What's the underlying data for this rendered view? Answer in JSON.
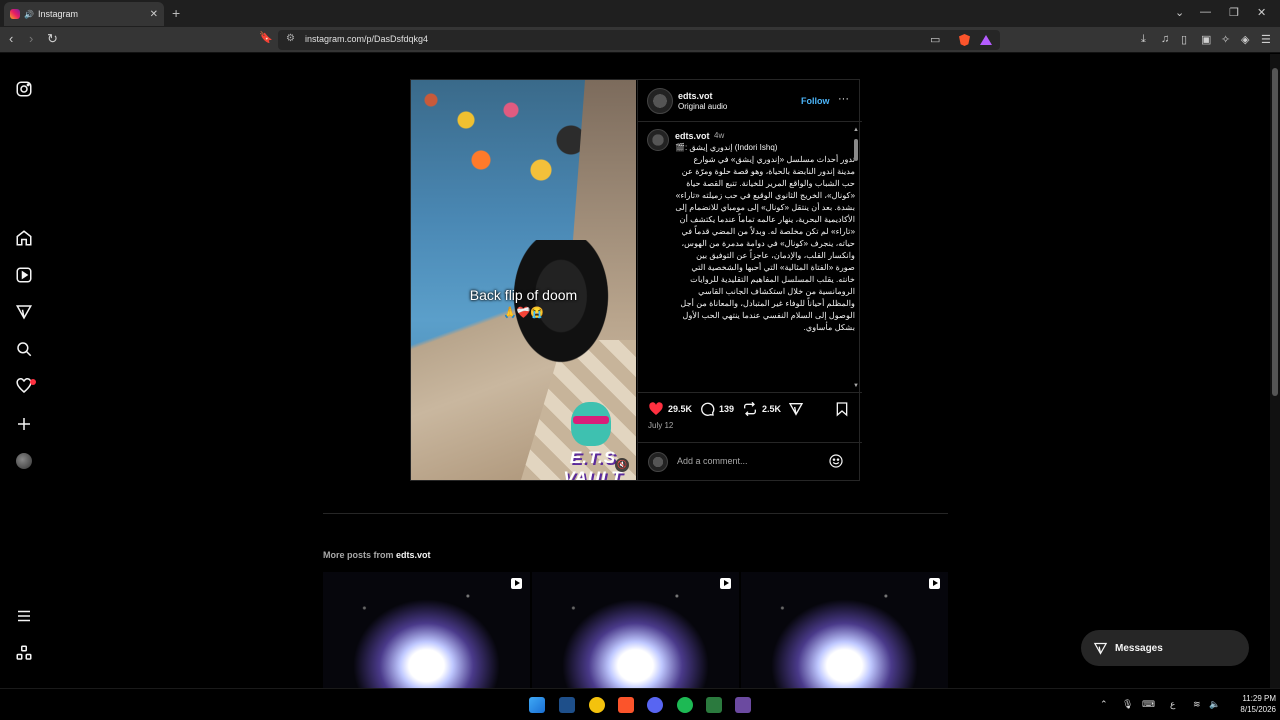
{
  "browser": {
    "tab_title": "Instagram",
    "tab_close": "✕",
    "new_tab": "+",
    "url": "instagram.com/p/DasDsfdqkg4",
    "window_controls": [
      "⌄",
      "—",
      "❐",
      "✕"
    ]
  },
  "post": {
    "username": "edts.vot",
    "audio": "Original audio",
    "follow_label": "Follow",
    "more_label": "···",
    "video_caption": "Back flip of doom",
    "video_caption_emoji": "🙏❤️‍🩹😭",
    "watermark": "E.T.S VAULT",
    "caption_user": "edts.vot",
    "caption_age": "4w",
    "caption_title": "🎬: إندوري إيشق (Indori Ishq)",
    "caption_body": "تدور أحداث مسلسل «إندوري إيشق» في شوارع مدينة إندور النابضة بالحياة، وهو قصة حلوة ومرّة عن حب الشباب والواقع المرير للخيانة. تتبع القصة حياة «كونال»، الخريج الثانوي الوقيع في حب زميلته «تاراء» بشدة. بعد أن ينتقل «كونال» إلى مومباي للانضمام إلى الأكاديمية البحرية، ينهار عالمه تماماً عندما يكتشف أن «تاراء» لم تكن مخلصة له. وبدلاً من المضي قدماً في حياته، ينجرف «كونال» في دوامة مدمرة من الهوس، وانكسار القلب، والإدمان، عاجزاً عن التوفيق بين صورة «الفتاة المثالية» التي أحبها والشخصية التي خانته. يقلب المسلسل المفاهيم التقليدية للروايات الرومانسية من خلال استكشاف الجانب القاسي والمظلم أحياناً للوفاء غير المتبادل، والمعاناة من أجل الوصول إلى السلام النفسي عندما ينتهي الحب الأول بشكل مأساوي.",
    "likes": "29.5K",
    "comments": "139",
    "reposts": "2.5K",
    "date": "July 12",
    "add_comment_placeholder": "Add a comment..."
  },
  "more_posts": {
    "prefix": "More posts from ",
    "user": "edts.vot"
  },
  "messages_label": "Messages",
  "nav_icons": [
    "instagram-icon",
    "home-icon",
    "reels-icon",
    "explore-icon",
    "search-icon",
    "notifications-icon",
    "create-icon",
    "profile-avatar",
    "menu-icon",
    "also-from-meta-icon"
  ],
  "taskbar": {
    "time": "11:29 PM",
    "date": "8/15/2026",
    "lang": "ع"
  },
  "colors": {
    "accent": "#4cb5f9",
    "like": "#ff3040",
    "bg": "#000000"
  }
}
